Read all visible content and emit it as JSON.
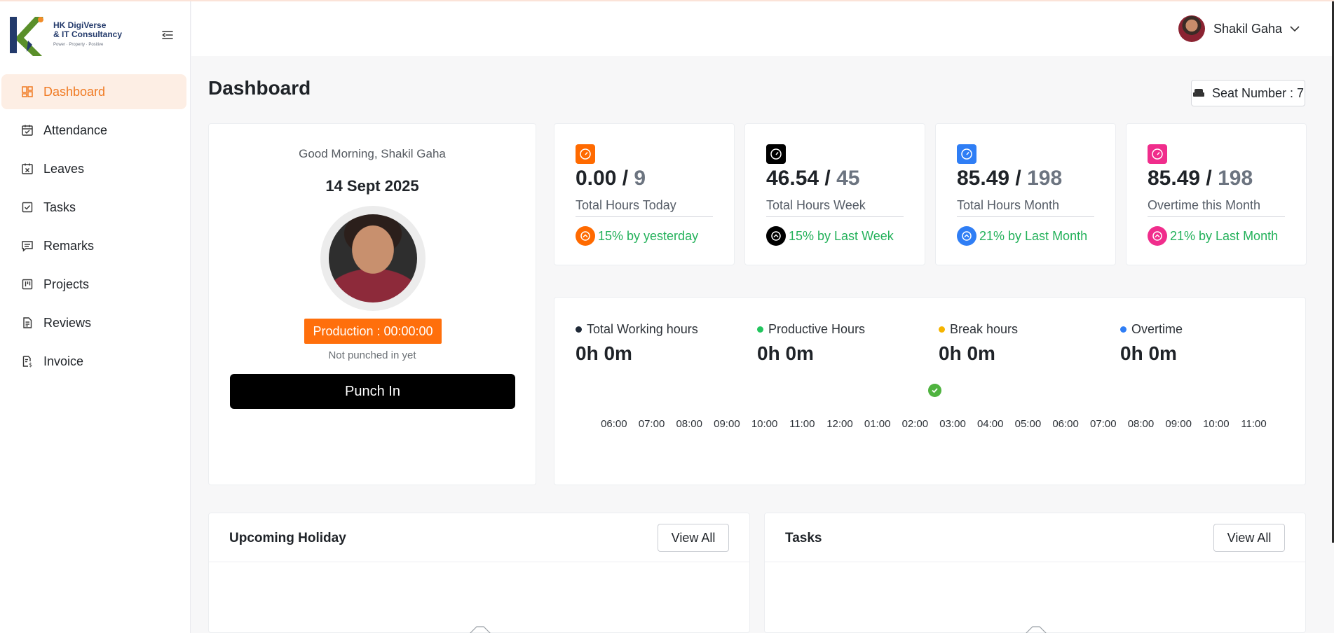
{
  "brand": {
    "line1": "HK DigiVerse",
    "line2": "& IT Consultancy",
    "tagline": "Power · Property · Positive"
  },
  "sidebar": {
    "items": [
      {
        "label": "Dashboard",
        "icon": "dashboard-icon",
        "active": true
      },
      {
        "label": "Attendance",
        "icon": "calendar-check-icon"
      },
      {
        "label": "Leaves",
        "icon": "calendar-x-icon"
      },
      {
        "label": "Tasks",
        "icon": "checkbox-icon"
      },
      {
        "label": "Remarks",
        "icon": "message-icon"
      },
      {
        "label": "Projects",
        "icon": "kanban-icon"
      },
      {
        "label": "Reviews",
        "icon": "document-icon"
      },
      {
        "label": "Invoice",
        "icon": "invoice-icon"
      }
    ]
  },
  "header": {
    "user_name": "Shakil Gaha"
  },
  "page": {
    "title": "Dashboard",
    "seat_label": "Seat Number : 7"
  },
  "profile": {
    "greeting": "Good Morning, Shakil Gaha",
    "date": "14 Sept 2025",
    "production": "Production : 00:00:00",
    "status": "Not punched in yet",
    "punch_label": "Punch In"
  },
  "stats": [
    {
      "value": "0.00",
      "total": "9",
      "label": "Total Hours Today",
      "trend": "15% by yesterday",
      "color": "#ff6a00"
    },
    {
      "value": "46.54",
      "total": "45",
      "label": "Total Hours Week",
      "trend": "15% by Last Week",
      "color": "#000000"
    },
    {
      "value": "85.49",
      "total": "198",
      "label": "Total Hours Month",
      "trend": "21% by Last Month",
      "color": "#2f7ef5"
    },
    {
      "value": "85.49",
      "total": "198",
      "label": "Overtime this Month",
      "trend": "21% by Last Month",
      "color": "#f02d8c"
    }
  ],
  "hours": {
    "items": [
      {
        "label": "Total Working hours",
        "value": "0h 0m",
        "color": "#1f2937"
      },
      {
        "label": "Productive Hours",
        "value": "0h 0m",
        "color": "#22c55e"
      },
      {
        "label": "Break hours",
        "value": "0h 0m",
        "color": "#f5b400"
      },
      {
        "label": "Overtime",
        "value": "0h 0m",
        "color": "#2f7ef5"
      }
    ],
    "timeline": [
      "06:00",
      "07:00",
      "08:00",
      "09:00",
      "10:00",
      "11:00",
      "12:00",
      "01:00",
      "02:00",
      "03:00",
      "04:00",
      "05:00",
      "06:00",
      "07:00",
      "08:00",
      "09:00",
      "10:00",
      "11:00"
    ]
  },
  "holiday": {
    "title": "Upcoming Holiday",
    "view_all": "View All"
  },
  "tasks": {
    "title": "Tasks",
    "view_all": "View All"
  }
}
